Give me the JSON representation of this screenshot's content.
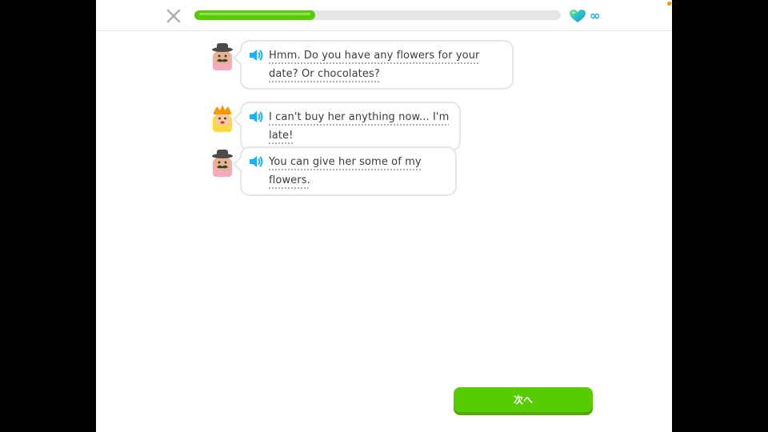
{
  "header": {
    "progress_fraction": 0.33,
    "hearts_count": "∞"
  },
  "dialogue": [
    {
      "speaker": "man-with-hat",
      "text": "Hmm. Do you have any flowers for your date? Or chocolates?"
    },
    {
      "speaker": "woman-with-crown",
      "text": "I can't buy her anything now... I'm late!"
    },
    {
      "speaker": "man-with-hat",
      "text": "You can give her some of my flowers."
    }
  ],
  "footer": {
    "next_label": "次へ"
  },
  "colors": {
    "accent_green": "#58cc02",
    "accent_blue": "#1cb0f6",
    "border_gray": "#e5e5e5"
  },
  "icons": [
    "close-icon",
    "heart-icon",
    "speaker-icon",
    "man-avatar-icon",
    "woman-avatar-icon"
  ]
}
